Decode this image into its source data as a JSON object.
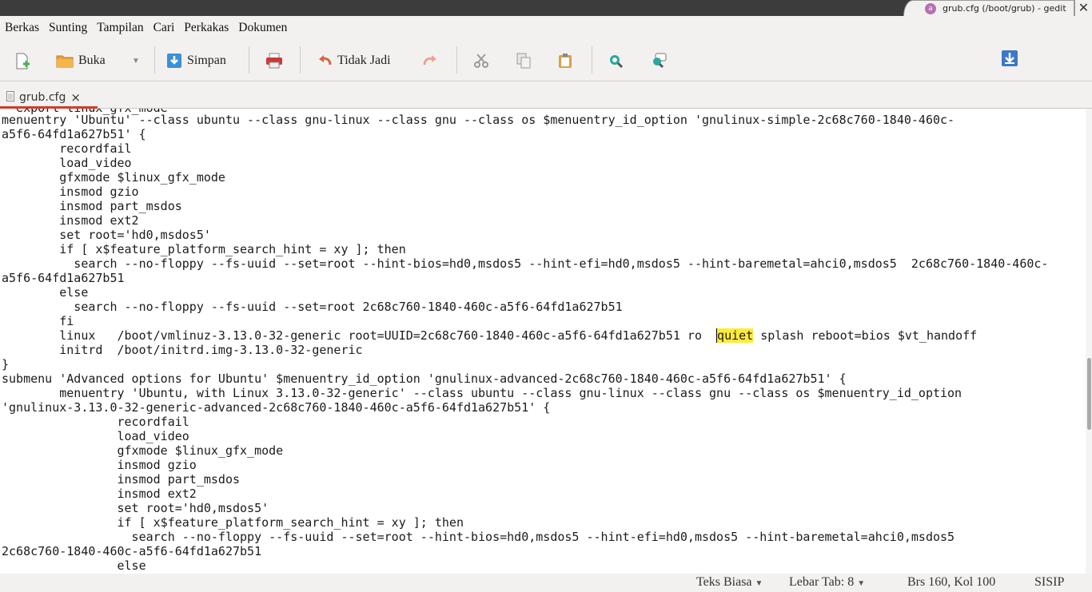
{
  "window": {
    "title": "grub.cfg (/boot/grub) - gedit",
    "close_glyph": "✕"
  },
  "menu": [
    "Berkas",
    "Sunting",
    "Tampilan",
    "Cari",
    "Perkakas",
    "Dokumen"
  ],
  "toolbar": {
    "open_label": "Buka",
    "save_label": "Simpan",
    "undo_label": "Tidak Jadi",
    "icons": [
      "new-document-icon",
      "open-folder-icon",
      "dropdown-icon",
      "save-icon",
      "print-icon",
      "undo-icon",
      "redo-icon",
      "cut-icon",
      "copy-icon",
      "paste-icon",
      "find-icon",
      "replace-icon",
      "download-icon"
    ]
  },
  "tab": {
    "label": "grub.cfg",
    "close_glyph": "×"
  },
  "editor": {
    "lines": [
      "menuentry 'Ubuntu' --class ubuntu --class gnu-linux --class gnu --class os $menuentry_id_option 'gnulinux-simple-2c68c760-1840-460c-",
      "a5f6-64fd1a627b51' {",
      "\trecordfail",
      "\tload_video",
      "\tgfxmode $linux_gfx_mode",
      "\tinsmod gzio",
      "\tinsmod part_msdos",
      "\tinsmod ext2",
      "\tset root='hd0,msdos5'",
      "\tif [ x$feature_platform_search_hint = xy ]; then",
      "\t  search --no-floppy --fs-uuid --set=root --hint-bios=hd0,msdos5 --hint-efi=hd0,msdos5 --hint-baremetal=ahci0,msdos5  2c68c760-1840-460c-",
      "a5f6-64fd1a627b51",
      "\telse",
      "\t  search --no-floppy --fs-uuid --set=root 2c68c760-1840-460c-a5f6-64fd1a627b51",
      "\tfi",
      "\tlinux\t/boot/vmlinuz-3.13.0-32-generic root=UUID=2c68c760-1840-460c-a5f6-64fd1a627b51 ro  quiet splash reboot=bios $vt_handoff",
      "\tinitrd\t/boot/initrd.img-3.13.0-32-generic",
      "}",
      "submenu 'Advanced options for Ubuntu' $menuentry_id_option 'gnulinux-advanced-2c68c760-1840-460c-a5f6-64fd1a627b51' {",
      "\tmenuentry 'Ubuntu, with Linux 3.13.0-32-generic' --class ubuntu --class gnu-linux --class gnu --class os $menuentry_id_option",
      "'gnulinux-3.13.0-32-generic-advanced-2c68c760-1840-460c-a5f6-64fd1a627b51' {",
      "\t\trecordfail",
      "\t\tload_video",
      "\t\tgfxmode $linux_gfx_mode",
      "\t\tinsmod gzio",
      "\t\tinsmod part_msdos",
      "\t\tinsmod ext2",
      "\t\tset root='hd0,msdos5'",
      "\t\tif [ x$feature_platform_search_hint = xy ]; then",
      "\t\t  search --no-floppy --fs-uuid --set=root --hint-bios=hd0,msdos5 --hint-efi=hd0,msdos5 --hint-baremetal=ahci0,msdos5",
      "2c68c760-1840-460c-a5f6-64fd1a627b51",
      "\t\telse"
    ],
    "highlight_word": "quiet",
    "highlight_color": "#ffeb3b"
  },
  "status": {
    "language": "Teks Biasa",
    "tab_width": "Lebar Tab: 8",
    "position": "Brs 160, Kol 100",
    "mode": "SISIP"
  },
  "colors": {
    "accent": "#d8382d",
    "chrome": "#f2f1f0"
  }
}
